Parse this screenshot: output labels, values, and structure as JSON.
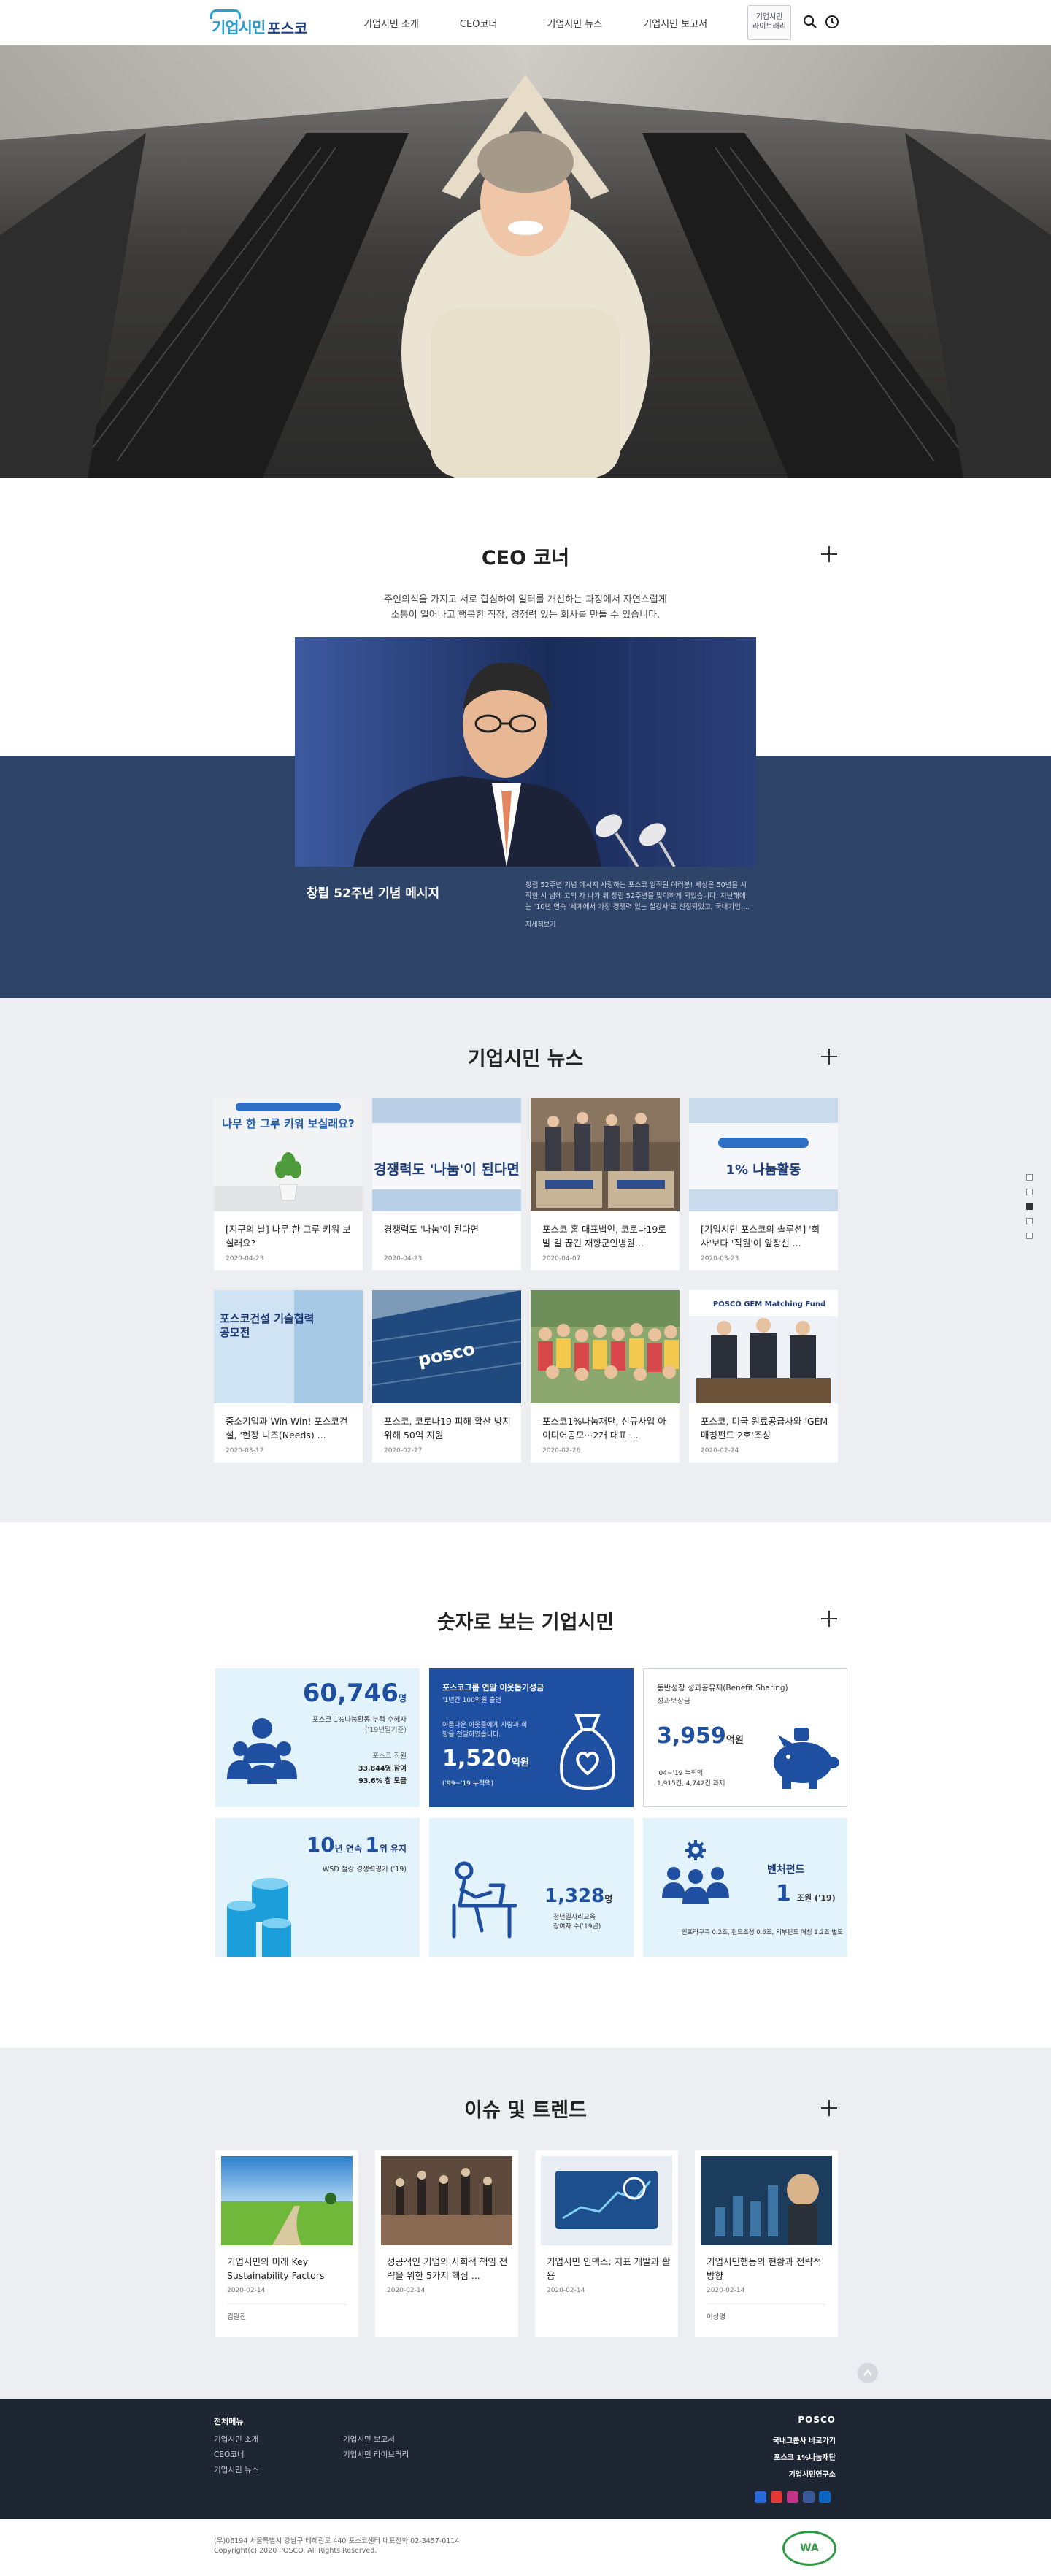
{
  "header": {
    "logo_part1": "기업시민",
    "logo_part2": "포스코",
    "nav": [
      "기업시민 소개",
      "CEO코너",
      "기업시민 뉴스",
      "기업시민 보고서"
    ],
    "badge_line1": "기업시민",
    "badge_line2": "라이브러리",
    "icons": [
      "search-icon",
      "clock-icon"
    ]
  },
  "ceo": {
    "title": "CEO 코너",
    "intro_line1": "주인의식을 가지고 서로 합심하여 일터를 개선하는 과정에서 자연스럽게",
    "intro_line2": "소통이 일어나고 행복한 직장, 경쟁력 있는 회사를 만들 수 있습니다.",
    "caption": "창립 52주년 기념 메시지",
    "desc": "창립 52주년 기념 메시지 사랑하는 포스코 임직원 여러분! 세상은 50년을 시작한 시 넘에 고의 자 나가 위 창립 52주년을 맞이하게 되었습니다. 지난해에는 '10년 연속 '세계에서 가장 경쟁력 있는 철강사'로 선정되었고, 국내기업 ...",
    "more": "자세히보기"
  },
  "news": {
    "title": "기업시민 뉴스",
    "items": [
      {
        "title": "[지구의 날] 나무 한 그루 키워 보실래요?",
        "date": "2020-04-23",
        "thumb_text": "나무 한 그루 키워 보실래요?"
      },
      {
        "title": "경쟁력도 '나눔'이 된다면",
        "date": "2020-04-23",
        "thumb_text": "경쟁력도 '나눔'이 된다면"
      },
      {
        "title": "포스코 홈 대표법인, 코로나19로 발 길 끊긴 재향군인병원...",
        "date": "2020-04-07",
        "thumb_text": ""
      },
      {
        "title": "[기업시민 포스코의 솔루션] '회사'보다 '직원'이 앞장선 ...",
        "date": "2020-03-23",
        "thumb_text": "1% 나눔활동"
      },
      {
        "title": "중소기업과 Win-Win! 포스코건설, '현장 니즈(Needs) ...",
        "date": "2020-03-12",
        "thumb_text": "포스코건설 기술협력 공모전"
      },
      {
        "title": "포스코, 코로나19 피해 확산 방지 위해 50억 지원",
        "date": "2020-02-27",
        "thumb_text": "posco"
      },
      {
        "title": "포스코1%나눔재단, 신규사업 아이디어공모···2개 대표 ...",
        "date": "2020-02-26",
        "thumb_text": ""
      },
      {
        "title": "포스코, 미국 원료공급사와 'GEM 매칭펀드 2호'조성",
        "date": "2020-02-24",
        "thumb_text": "POSCO GEM Matching Fund"
      }
    ]
  },
  "stats": {
    "title": "숫자로 보는 기업시민",
    "s1": {
      "num": "60,746",
      "unit": "명",
      "sub1": "포스코 1%나눔활동 누적 수혜자",
      "sub1b": "('19년말기준)",
      "row1_label": "포스코 직원",
      "row1_val": "33,844명 참여",
      "row2_val": "93.6% 참 모금"
    },
    "s2": {
      "head": "포스코그룹 연말 이웃돕기성금",
      "sub": "'1년간 100억원 출연",
      "lines": "아름다운 이웃들에게 사랑과 희망을 전달하였습니다.",
      "num": "1,520",
      "unit": "억원",
      "years": "('99~'19 누적액)"
    },
    "s3": {
      "head": "동반성장 성과공유제(Benefit Sharing)",
      "sub": "성과보상금",
      "num": "3,959",
      "unit": "억원",
      "note1": "'04~'19 누적액",
      "note2": "1,915건, 4,742건 과제"
    },
    "s4": {
      "num": "10",
      "mid": "년 연속",
      "rank": "1",
      "tail": "위 유지",
      "sub": "WSD 철강 경쟁력평가 ('19)"
    },
    "s5": {
      "num": "1,328",
      "unit": "명",
      "sub1": "청년일자리교육",
      "sub2": "참여자 수('19년)"
    },
    "s6": {
      "head": "벤처펀드",
      "num": "1",
      "unit": "조원 ('19)",
      "note": "인프라구축 0.2조, 펀드조성 0.6조, 외부펀드 매칭 1.2조 별도"
    }
  },
  "trends": {
    "title": "이슈 및 트렌드",
    "items": [
      {
        "title": "기업시민의 미래 Key Sustainability Factors",
        "date": "2020-02-14",
        "author": "김원진"
      },
      {
        "title": "성공적인 기업의 사회적 책임 전략을 위한 5가지 핵심 ...",
        "date": "2020-02-14",
        "author": ""
      },
      {
        "title": "기업시민 인덱스: 지표 개발과 활용",
        "date": "2020-02-14",
        "author": ""
      },
      {
        "title": "기업시민행동의 현황과 전략적 방향",
        "date": "2020-02-14",
        "author": "이상명"
      }
    ]
  },
  "footer": {
    "heading": "전체메뉴",
    "col1": [
      "기업시민 소개",
      "CEO코너",
      "기업시민 뉴스"
    ],
    "col2": [
      "기업시민 보고서",
      "기업시민 라이브러리"
    ],
    "right": [
      "POSCO",
      "국내그룹사 바로가기",
      "포스코 1%나눔재단",
      "기업시민연구소"
    ],
    "address": "(우)06194 서울특별시 강남구 테헤란로 440 포스코센터 대표전화 02-3457-0114",
    "copyright": "Copyright(c) 2020 POSCO. All Rights Reserved.",
    "wa_mark": "WA"
  },
  "colors": {
    "accent": "#2a9fd0",
    "navy": "#2f4469",
    "stat_blue": "#1f4fa0",
    "light_blue": "#e3f3fb",
    "footer": "#1f2633"
  }
}
